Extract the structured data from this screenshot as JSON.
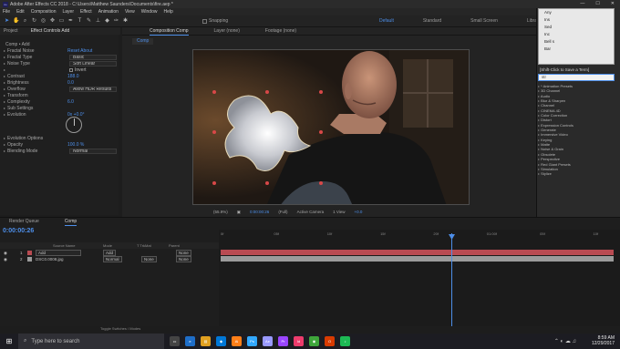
{
  "window": {
    "title": "Adobe After Effects CC 2018 - C:\\Users\\Matthew Saunders\\Documents\\fire.aep *"
  },
  "menu": [
    "File",
    "Edit",
    "Composition",
    "Layer",
    "Effect",
    "Animation",
    "View",
    "Window",
    "Help"
  ],
  "toolbar": {
    "snapping": "Snapping",
    "workspaces": [
      "Default",
      "Standard",
      "Small Screen",
      "Libraries"
    ]
  },
  "left_panel": {
    "tabs": [
      "Project",
      "Effect Controls Add"
    ],
    "effects": [
      {
        "label": "Comp • Add",
        "value": ""
      },
      {
        "label": "Fractal Noise",
        "value": "Reset     About"
      },
      {
        "label": "Fractal Type",
        "select": "Basic"
      },
      {
        "label": "Noise Type",
        "select": "Soft Linear"
      },
      {
        "label": "",
        "checkbox": "Invert"
      },
      {
        "label": "Contrast",
        "value": "188.0"
      },
      {
        "label": "Brightness",
        "value": "0.0"
      },
      {
        "label": "Overflow",
        "select": "Allow HDR Results"
      },
      {
        "label": "Transform",
        "value": ""
      },
      {
        "label": "Complexity",
        "value": "6.0"
      },
      {
        "label": "Sub Settings",
        "value": ""
      },
      {
        "label": "Evolution",
        "value": "0x +0.0°"
      },
      {
        "label": "Evolution Options",
        "value": ""
      },
      {
        "label": "Opacity",
        "value": "100.0 %"
      },
      {
        "label": "Blending Mode",
        "select": "Normal"
      }
    ]
  },
  "composition": {
    "tabs": [
      "Composition Comp",
      "Layer (none)",
      "Footage (none)"
    ],
    "sub_tab": "Comp",
    "viewer_bar": {
      "zoom": "(55.9%)",
      "time": "0:00:00:26",
      "quality": "(Full)",
      "camera": "Active Camera",
      "views": "1 View",
      "extra": "+0.0"
    }
  },
  "presets": {
    "dropdown": [
      "Any",
      "Ins",
      "Sed",
      "Inc",
      "Bell s",
      "Bar"
    ],
    "search_title": "[Shift-Click to Save a Term]",
    "search_value": "str",
    "items": [
      "* Animation Presets",
      "3D Channel",
      "Audio",
      "Blur & Sharpen",
      "Channel",
      "CINEMA 4D",
      "Color Correction",
      "Distort",
      "Expression Controls",
      "Generate",
      "Immersive Video",
      "Keying",
      "Matte",
      "Noise & Grain",
      "Obsolete",
      "Perspective",
      "Red Giant Presets",
      "Simulation",
      "Stylize"
    ]
  },
  "timeline": {
    "tabs": [
      "Render Queue",
      "Comp"
    ],
    "timecode": "0:00:00:26",
    "columns": [
      "Source Name",
      "Mode",
      "T TrkMat",
      "Parent"
    ],
    "layers": [
      {
        "num": "1",
        "name": "Add",
        "mode": "Add",
        "trkmat": "",
        "parent": "None",
        "color": "#b94b52"
      },
      {
        "num": "2",
        "name": "DSC0.0008.jpg",
        "mode": "Normal",
        "trkmat": "None",
        "parent": "None",
        "color": "#9b9b9b"
      }
    ],
    "ruler": [
      "0f",
      "05f",
      "10f",
      "15f",
      "20f",
      "01:00f",
      "05f",
      "10f"
    ],
    "footer": "Toggle Switches / Modes"
  },
  "taskbar": {
    "search": "Type here to search",
    "time": "8:59 AM",
    "date": "12/29/2017"
  },
  "colors": {
    "accent": "#4d8ee8",
    "layer_red": "#b94b52",
    "layer_gray": "#9b9b9b"
  }
}
